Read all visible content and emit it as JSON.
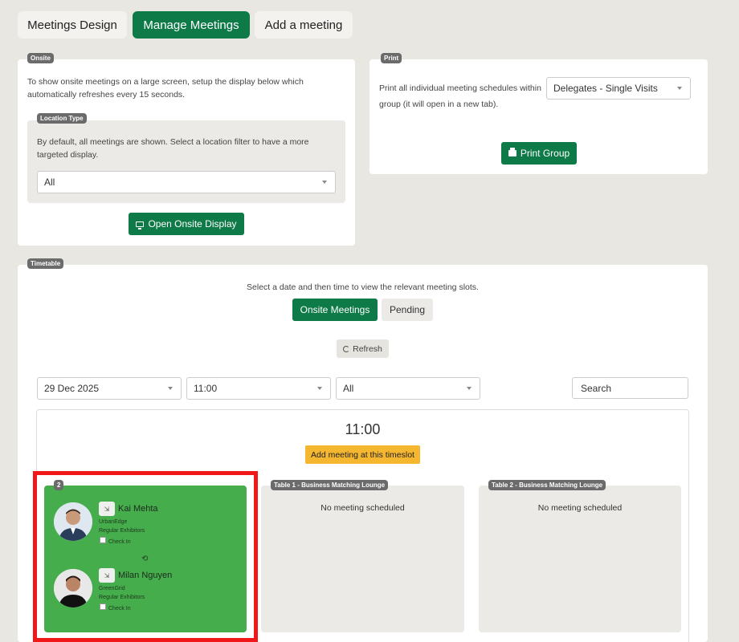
{
  "tabs": [
    {
      "label": "Meetings Design",
      "active": false
    },
    {
      "label": "Manage Meetings",
      "active": true
    },
    {
      "label": "Add a meeting",
      "active": false
    }
  ],
  "onsite": {
    "badge": "Onsite",
    "description": "To show onsite meetings on a large screen, setup the display below which automatically refreshes every 15 seconds.",
    "location_type": {
      "badge": "Location Type",
      "description": "By default, all meetings are shown. Select a location filter to have a more targeted display.",
      "selected": "All"
    },
    "open_button": "Open Onsite Display"
  },
  "print": {
    "badge": "Print",
    "description": "Print all individual meeting schedules within group (it will open in a new tab).",
    "selected": "Delegates - Single Visits",
    "button": "Print Group"
  },
  "timetable": {
    "badge": "Timetable",
    "instructions": "Select a date and then time to view the relevant meeting slots.",
    "onsite_button": "Onsite Meetings",
    "pending_button": "Pending",
    "refresh_button": "Refresh",
    "filters": {
      "date": "29 Dec 2025",
      "time": "11:00",
      "location": "All",
      "search_placeholder": "Search"
    },
    "slot": {
      "time": "11:00",
      "add_button": "Add meeting at this timeslot",
      "tables": [
        {
          "badge": "2",
          "status": "booked",
          "participants": [
            {
              "name": "Kai Mehta",
              "company": "UrbanEdge",
              "group": "Regular Exhibitors",
              "checkin": "Check In"
            },
            {
              "name": "Milan Nguyen",
              "company": "GreenGrid",
              "group": "Regular Exhibitors",
              "checkin": "Check In"
            }
          ]
        },
        {
          "badge": "Table 1 - Business Matching Lounge",
          "status": "No meeting scheduled"
        },
        {
          "badge": "Table 2 - Business Matching Lounge",
          "status": "No meeting scheduled"
        }
      ]
    }
  },
  "colors": {
    "primary": "#0e7a48",
    "booked": "#46ad4c",
    "add": "#f5b730",
    "highlight": "#f01818"
  }
}
